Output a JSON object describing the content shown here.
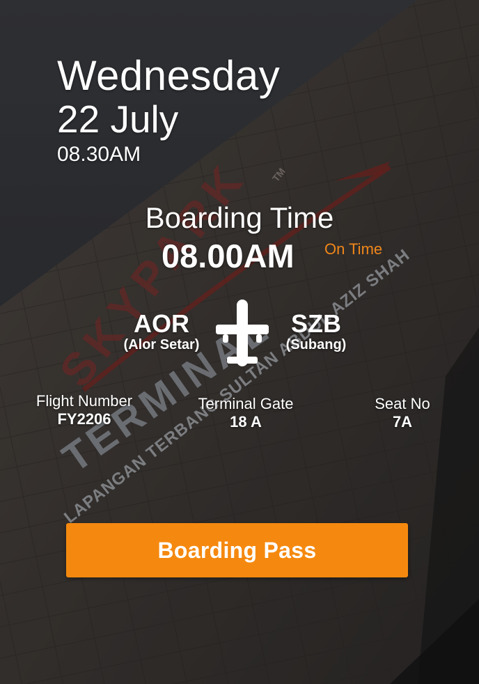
{
  "date": {
    "weekday": "Wednesday",
    "day_month": "22 July",
    "time": "08.30AM"
  },
  "boarding": {
    "label": "Boarding Time",
    "time": "08.00AM",
    "status": "On Time",
    "status_color": "#f0871a"
  },
  "route": {
    "origin": {
      "code": "AOR",
      "city": "(Alor Setar)"
    },
    "destination": {
      "code": "SZB",
      "city": "(Subang)"
    },
    "icon": "airplane-icon"
  },
  "details": {
    "flight_number_label": "Flight Number",
    "flight_number": "FY2206",
    "terminal_gate_label": "Terminal Gate",
    "terminal_gate": "18 A",
    "seat_label": "Seat No",
    "seat": "7A"
  },
  "action": {
    "label": "Boarding Pass",
    "color": "#f5890f"
  },
  "background": {
    "sign_line1": "SKYPARK",
    "sign_tm": "TM",
    "sign_line2": "TERMINAL",
    "sign_line3": "LAPANGAN TERBANG SULTAN ABDUL AZIZ SHAH"
  }
}
